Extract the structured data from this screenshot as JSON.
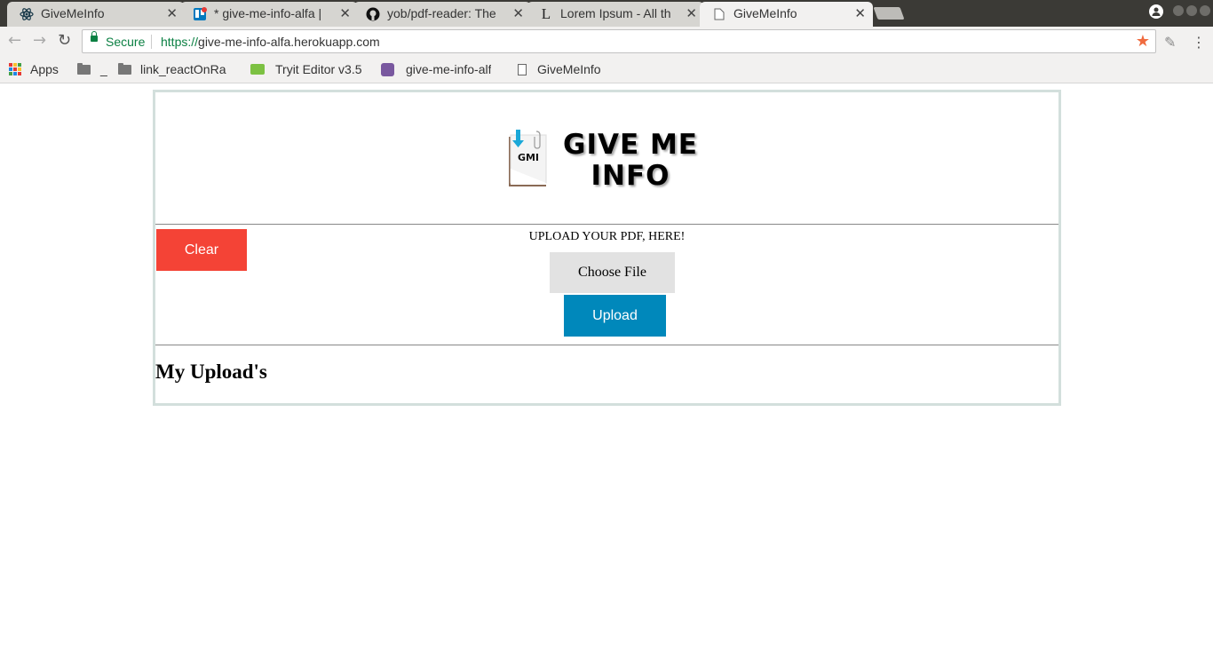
{
  "browser": {
    "tabs": [
      {
        "title": "GiveMeInfo",
        "icon": "react-icon",
        "active": false
      },
      {
        "title": "* give-me-info-alfa | ",
        "icon": "trello-icon",
        "active": false
      },
      {
        "title": "yob/pdf-reader: The",
        "icon": "github-icon",
        "active": false
      },
      {
        "title": "Lorem Ipsum - All th",
        "icon": "lorem-ipsum-icon",
        "active": false
      },
      {
        "title": "GiveMeInfo",
        "icon": "page-icon",
        "active": true
      }
    ],
    "close_glyph": "✕",
    "omnibox": {
      "secure_label": "Secure",
      "url_scheme": "https://",
      "url_rest": "give-me-info-alfa.herokuapp.com"
    },
    "bookmarks": [
      {
        "label": "Apps",
        "icon": "apps-grid-icon"
      },
      {
        "label": "",
        "icon": "folder-icon"
      },
      {
        "label": "_",
        "icon": "folder-icon"
      },
      {
        "label": "link_reactOnRa",
        "icon": "folder-icon"
      },
      {
        "label": "Tryit Editor v3.5",
        "icon": "w3schools-icon"
      },
      {
        "label": "give-me-info-alf",
        "icon": "heroku-icon"
      },
      {
        "label": "GiveMeInfo",
        "icon": "page-icon"
      }
    ],
    "colors": {
      "secure": "#0b8043",
      "star": "#f06b3f"
    }
  },
  "page": {
    "logo": {
      "badge_text": "GMI",
      "line1": "GIVE ME",
      "line2": "INFO"
    },
    "clear_label": "Clear",
    "upload_prompt": "UPLOAD YOUR PDF, HERE!",
    "choose_file_label": "Choose File",
    "upload_label": "Upload",
    "uploads_heading": "My Upload's",
    "colors": {
      "clear": "#f44336",
      "upload": "#0088bb",
      "choose": "#e2e2e2",
      "border": "#d3dfdc"
    }
  }
}
